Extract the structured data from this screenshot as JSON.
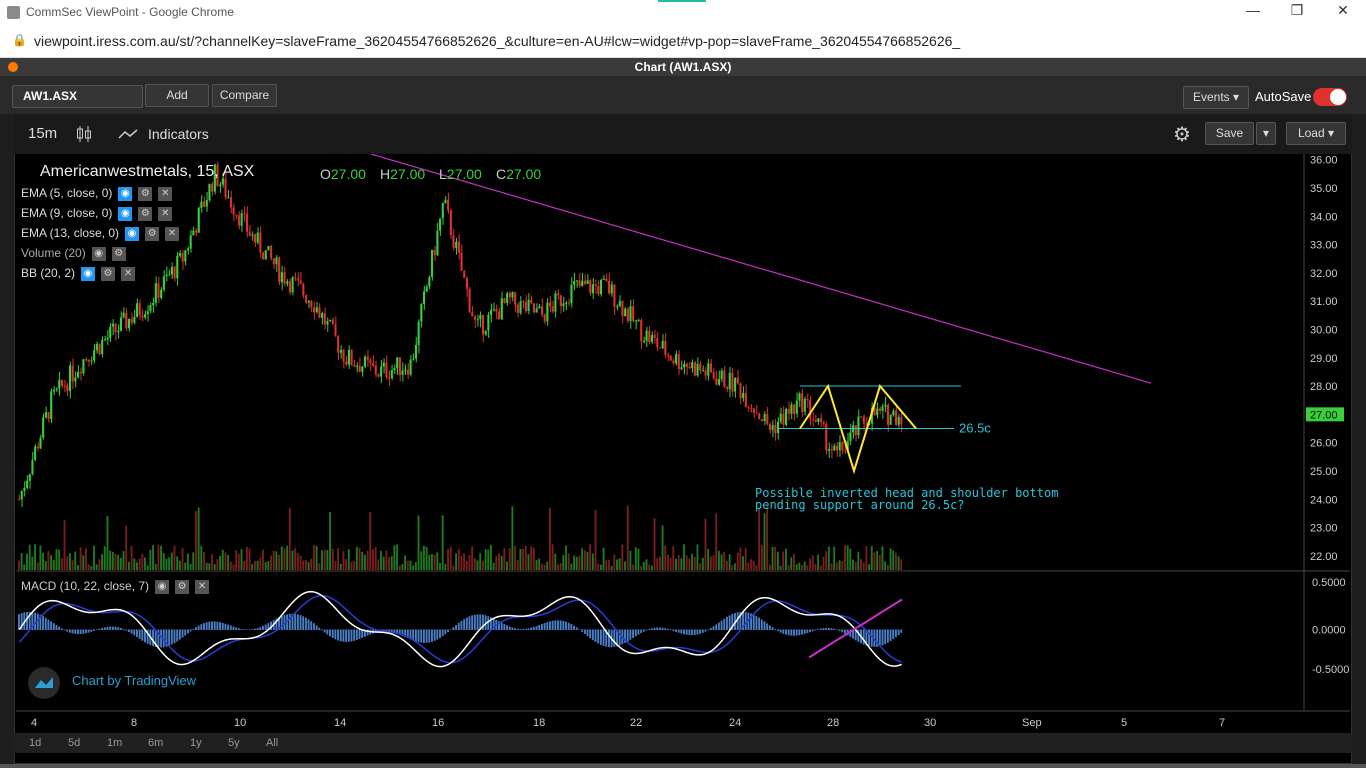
{
  "browser": {
    "title": "CommSec ViewPoint - Google Chrome",
    "url": "viewpoint.iress.com.au/st/?channelKey=slaveFrame_36204554766852626_&culture=en-AU#lcw=widget#vp-pop=slaveFrame_36204554766852626_"
  },
  "app": {
    "title": "Chart (AW1.ASX)"
  },
  "toolbar": {
    "symbol": "AW1.ASX",
    "add": "Add",
    "compare": "Compare",
    "events": "Events",
    "autosave": "AutoSave"
  },
  "chart_head": {
    "timeframe": "15m",
    "indicators": "Indicators",
    "save": "Save",
    "load": "Load"
  },
  "legend": {
    "symbol": "Americanwestmetals, 15, ASX",
    "o_label": "O",
    "o": "27.00",
    "h_label": "H",
    "h": "27.00",
    "l_label": "L",
    "l": "27.00",
    "c_label": "C",
    "c": "27.00",
    "studies": [
      "EMA (5, close, 0)",
      "EMA (9, close, 0)",
      "EMA (13, close, 0)",
      "Volume (20)",
      "BB (20, 2)"
    ],
    "macd": "MACD (10, 22, close, 7)"
  },
  "annotations": {
    "level": "26.5c",
    "note_line1": "Possible inverted head and shoulder bottom",
    "note_line2": "pending support around 26.5c?"
  },
  "price_axis": [
    "36.00",
    "35.00",
    "34.00",
    "33.00",
    "32.00",
    "31.00",
    "30.00",
    "29.00",
    "28.00",
    "27.00",
    "26.00",
    "25.00",
    "24.00",
    "23.00",
    "22.00"
  ],
  "current_price": "27.00",
  "macd_axis": [
    "0.5000",
    "0.0000",
    "-0.5000"
  ],
  "time_axis": [
    "4",
    "8",
    "10",
    "14",
    "16",
    "18",
    "22",
    "24",
    "28",
    "30",
    "Sep",
    "5",
    "7"
  ],
  "ranges": [
    "1d",
    "5d",
    "1m",
    "6m",
    "1y",
    "5y",
    "All"
  ],
  "branding": "Chart by TradingView",
  "chart_data": {
    "type": "line",
    "title": "Americanwestmetals, 15, ASX",
    "xlabel": "",
    "ylabel": "",
    "ylim": [
      21.5,
      36.2
    ],
    "x": [
      "4",
      "5",
      "6",
      "7",
      "8",
      "9",
      "10",
      "11",
      "12",
      "13",
      "14",
      "15",
      "16",
      "17",
      "18",
      "19",
      "20",
      "21",
      "22",
      "23",
      "24",
      "25",
      "26",
      "27",
      "28",
      "28.5",
      "29",
      "29.5"
    ],
    "series": [
      {
        "name": "",
        "values": [
          24,
          27.5,
          29,
          30,
          31,
          32.5,
          35.5,
          33.5,
          32,
          31,
          29,
          28.5,
          28.8,
          34.5,
          30,
          31,
          30.5,
          31.5,
          31.5,
          30,
          29,
          28.5,
          28,
          26.5,
          27.5,
          25.5,
          27,
          27
        ]
      }
    ],
    "colors": {
      "up": "#38d13a",
      "down": "#e0312f",
      "trendline": "#c82fc8",
      "pattern": "#ffe82e",
      "level": "#26c6da"
    }
  }
}
